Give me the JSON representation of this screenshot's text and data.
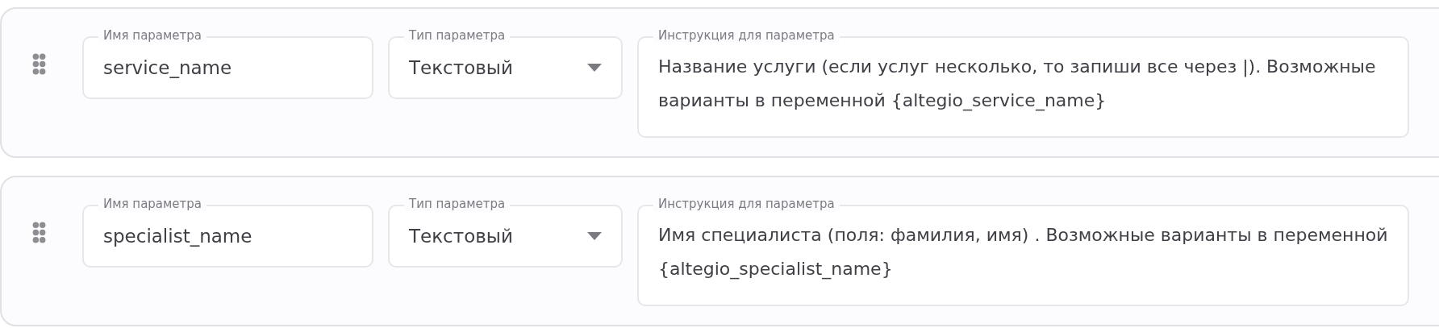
{
  "parameters": [
    {
      "name_label": "Имя параметра",
      "name": "service_name",
      "type_label": "Тип параметра",
      "type": "Текстовый",
      "instruction_label": "Инструкция для параметра",
      "instruction": "Название услуги (если услуг несколько, то запиши все через |). Возможные варианты в переменной {altegio_service_name}"
    },
    {
      "name_label": "Имя параметра",
      "name": "specialist_name",
      "type_label": "Тип параметра",
      "type": "Текстовый",
      "instruction_label": "Инструкция для параметра",
      "instruction": "Имя специалиста (поля: фамилия, имя) . Возможные варианты в переменной {altegio_specialist_name}"
    }
  ]
}
